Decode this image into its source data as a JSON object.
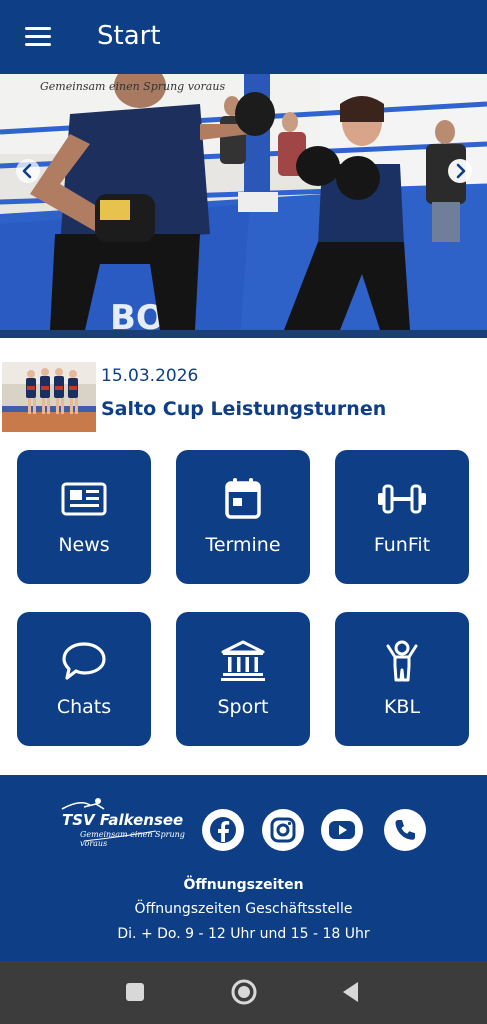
{
  "appbar": {
    "title": "Start",
    "menu_icon": "hamburger-menu-icon",
    "color": "#0e3f86"
  },
  "hero": {
    "watermark": "Gemeinsam einen Sprung voraus",
    "prev_icon": "chevron-left-icon",
    "next_icon": "chevron-right-icon"
  },
  "news": {
    "date": "15.03.2026",
    "title": "Salto Cup Leistungsturnen"
  },
  "tiles": [
    {
      "label": "News",
      "icon": "newspaper-icon"
    },
    {
      "label": "Termine",
      "icon": "calendar-icon"
    },
    {
      "label": "FunFit",
      "icon": "dumbbell-icon"
    },
    {
      "label": "Chats",
      "icon": "chat-bubble-icon"
    },
    {
      "label": "Sport",
      "icon": "building-columns-icon"
    },
    {
      "label": "KBL",
      "icon": "child-icon"
    }
  ],
  "footer": {
    "brand_name": "TSV Falkensee",
    "brand_slogan": "Gemeinsam einen Sprung voraus",
    "social": [
      "facebook-icon",
      "instagram-icon",
      "youtube-icon",
      "phone-icon"
    ],
    "hours_heading": "Öffnungszeiten",
    "hours_office": "Öffnungszeiten Geschäftsstelle",
    "hours_times": "Di. + Do. 9 - 12 Uhr und 15 - 18 Uhr"
  },
  "system_nav": {
    "items": [
      "recents-square-icon",
      "home-circle-icon",
      "back-triangle-icon"
    ],
    "background": "#3c3c3c"
  }
}
